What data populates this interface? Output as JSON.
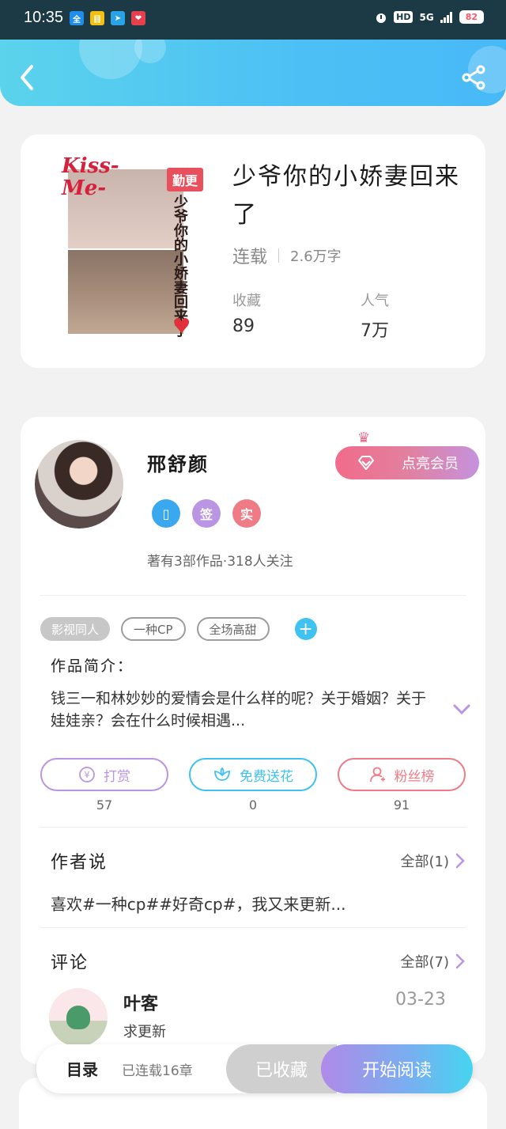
{
  "status_bar": {
    "time": "10:35",
    "network": "5G",
    "hd": "HD",
    "battery": "82",
    "apps": [
      {
        "name": "quanmin-app-icon",
        "label": "全",
        "color": "#1e8ee8"
      },
      {
        "name": "news-app-icon",
        "label": "目",
        "color": "#f3c012"
      },
      {
        "name": "telegram-app-icon",
        "label": "➤",
        "color": "#2aa3e6"
      },
      {
        "name": "heart-app-icon",
        "label": "❤",
        "color": "#e5414d"
      }
    ]
  },
  "header": {
    "back_icon": "chevron-left-icon",
    "share_icon": "share-icon"
  },
  "book": {
    "cover": {
      "kiss_text": "Kiss-\nMe-",
      "badge": "勤更",
      "vertical_title": "少爷你的小娇妻回来了"
    },
    "title": "少爷你的小娇妻回来了",
    "status": "连载",
    "word_count": "2.6万字",
    "stats": [
      {
        "label": "收藏",
        "value": "89"
      },
      {
        "label": "人气",
        "value": "7万"
      }
    ]
  },
  "author": {
    "name": "邢舒颜",
    "vip_button": "点亮会员",
    "badges": [
      {
        "name": "phone-badge-icon",
        "text": "▯",
        "color": "#3aa8ef"
      },
      {
        "name": "sign-badge-icon",
        "text": "签",
        "color": "#b995e3"
      },
      {
        "name": "real-badge-icon",
        "text": "实",
        "color": "#ef7b86"
      }
    ],
    "info": "著有3部作品·318人关注"
  },
  "tags": [
    "影视同人",
    "一种CP",
    "全场高甜"
  ],
  "intro": {
    "label": "作品简介：",
    "text": "钱三一和林妙妙的爱情会是什么样的呢？关于婚姻？关于娃娃亲？会在什么时候相遇..."
  },
  "actions": [
    {
      "name": "reward-button",
      "icon": "yen-icon",
      "label": "打赏",
      "count": "57",
      "color": "#b995e3"
    },
    {
      "name": "send-flower-button",
      "icon": "flower-icon",
      "label": "免费送花",
      "count": "0",
      "color": "#3fc2ef"
    },
    {
      "name": "fans-rank-button",
      "icon": "user-icon",
      "label": "粉丝榜",
      "count": "91",
      "color": "#ef7b86"
    }
  ],
  "author_say": {
    "title": "作者说",
    "more": "全部(1)",
    "text": "喜欢#一种cp##好奇cp#，我又来更新..."
  },
  "comments": {
    "title": "评论",
    "more": "全部(7)",
    "items": [
      {
        "user": "叶客",
        "text": "求更新",
        "date": "03-23"
      }
    ]
  },
  "bottom_bar": {
    "toc": "目录",
    "chapters": "已连载16章",
    "collected": "已收藏",
    "read": "开始阅读"
  }
}
